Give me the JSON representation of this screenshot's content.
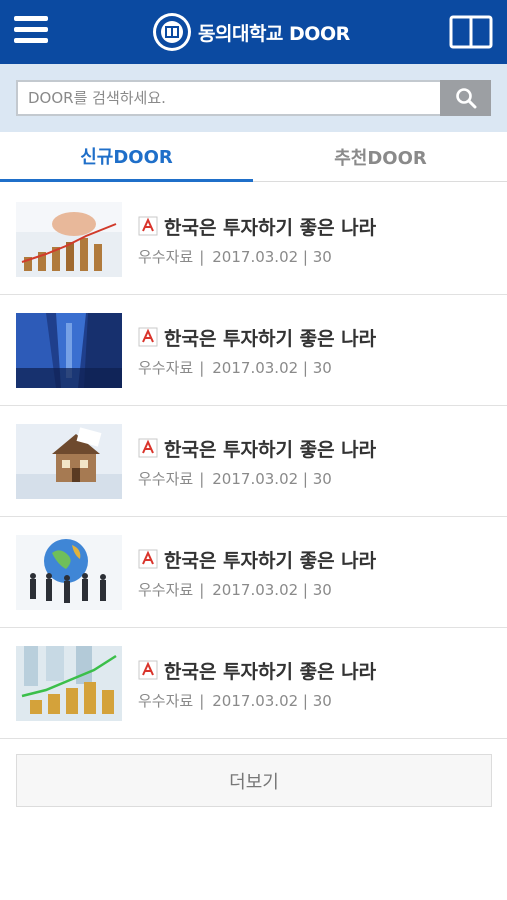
{
  "header": {
    "title": "동의대학교 DOOR",
    "icons": {
      "menu": "hamburger-menu-icon",
      "logo": "university-seal-logo",
      "book": "open-book-icon"
    },
    "colors": {
      "background": "#0b4aa1",
      "text": "#ffffff"
    }
  },
  "search": {
    "placeholder": "DOOR를 검색하세요.",
    "value": "",
    "icon": "search-icon"
  },
  "tabs": [
    {
      "label": "신규DOOR",
      "active": true
    },
    {
      "label": "추천DOOR",
      "active": false
    }
  ],
  "items": [
    {
      "title": "한국은 투자하기 좋은 나라",
      "category": "우수자료",
      "date": "2017.03.02",
      "count": "30",
      "thumb": "coins-chart"
    },
    {
      "title": "한국은 투자하기 좋은 나라",
      "category": "우수자료",
      "date": "2017.03.02",
      "count": "30",
      "thumb": "skyscrapers"
    },
    {
      "title": "한국은 투자하기 좋은 나라",
      "category": "우수자료",
      "date": "2017.03.02",
      "count": "30",
      "thumb": "house-model"
    },
    {
      "title": "한국은 투자하기 좋은 나라",
      "category": "우수자료",
      "date": "2017.03.02",
      "count": "30",
      "thumb": "globe-businessmen"
    },
    {
      "title": "한국은 투자하기 좋은 나라",
      "category": "우수자료",
      "date": "2017.03.02",
      "count": "30",
      "thumb": "coin-stacks-growth"
    }
  ],
  "more_label": "더보기",
  "colors": {
    "accent": "#1f6fc9",
    "inactive_tab": "#8a8a8a",
    "search_bg": "#dbe7f3",
    "pdf_red": "#d9342b"
  }
}
